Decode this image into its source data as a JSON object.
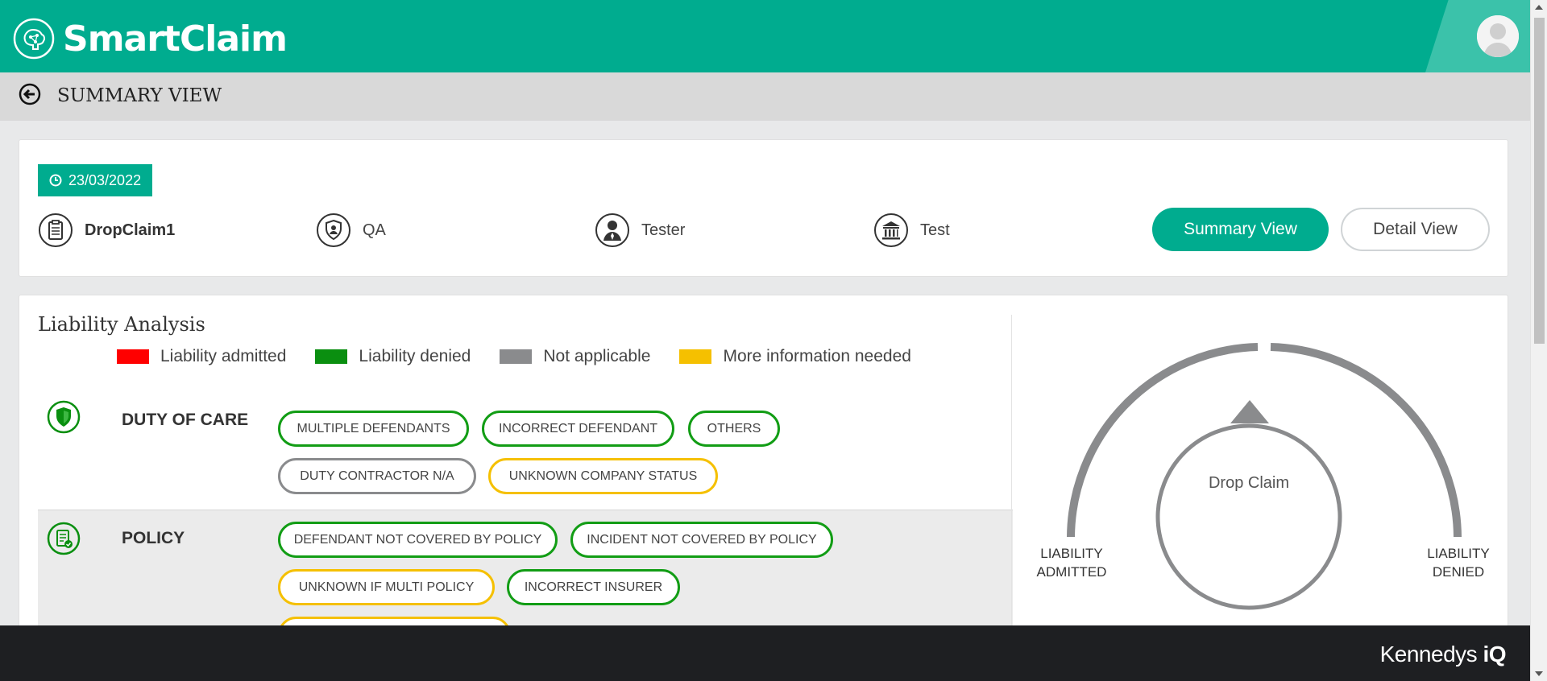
{
  "app": {
    "name": "SmartClaim"
  },
  "subheader": {
    "title": "SUMMARY VIEW"
  },
  "claim": {
    "date": "23/03/2022",
    "name": "DropClaim1",
    "team": "QA",
    "user": "Tester",
    "organisation": "Test"
  },
  "view_toggle": {
    "summary_label": "Summary View",
    "detail_label": "Detail View",
    "active": "summary"
  },
  "liability": {
    "title": "Liability Analysis",
    "legend": [
      {
        "label": "Liability admitted",
        "color": "#ff0000"
      },
      {
        "label": "Liability denied",
        "color": "#0a8f10"
      },
      {
        "label": "Not applicable",
        "color": "#8a8b8d"
      },
      {
        "label": "More information needed",
        "color": "#f5c000"
      }
    ],
    "categories": [
      {
        "label": "DUTY OF CARE",
        "icon": "shield-icon",
        "tags": [
          {
            "label": "MULTIPLE DEFENDANTS",
            "status": "denied"
          },
          {
            "label": "INCORRECT DEFENDANT",
            "status": "denied"
          },
          {
            "label": "OTHERS",
            "status": "denied"
          },
          {
            "label": "DUTY CONTRACTOR N/A",
            "status": "not-applicable"
          },
          {
            "label": "UNKNOWN COMPANY STATUS",
            "status": "more-info"
          }
        ]
      },
      {
        "label": "POLICY",
        "icon": "policy-document-icon",
        "tags": [
          {
            "label": "DEFENDANT NOT COVERED BY POLICY",
            "status": "denied"
          },
          {
            "label": "INCIDENT NOT COVERED BY POLICY",
            "status": "denied"
          },
          {
            "label": "UNKNOWN IF MULTI POLICY",
            "status": "more-info"
          },
          {
            "label": "INCORRECT INSURER",
            "status": "denied"
          },
          {
            "label": "",
            "status": "more-info"
          }
        ]
      }
    ]
  },
  "gauge": {
    "left_label_line1": "LIABILITY",
    "left_label_line2": "ADMITTED",
    "right_label_line1": "LIABILITY",
    "right_label_line2": "DENIED",
    "center_text": "Drop Claim",
    "arc_color": "#8a8b8d"
  },
  "footer": {
    "brand": "Kennedys",
    "brand_suffix": "iQ"
  }
}
